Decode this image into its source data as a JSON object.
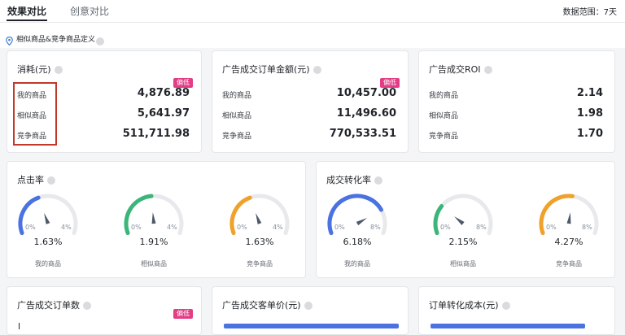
{
  "tabs": [
    {
      "label": "效果对比",
      "active": true
    },
    {
      "label": "创意对比",
      "active": false
    }
  ],
  "range_label": "数据范围：7天",
  "subheader": {
    "label": "相似商品&竞争商品定义"
  },
  "colors": {
    "badge": "#e33d86",
    "gauge_mine": "#4a72e0",
    "gauge_similar": "#3bb57a",
    "gauge_competitor": "#f0a12a",
    "track": "#e8e9ec",
    "highlight": "#c0392b"
  },
  "cards": {
    "spend": {
      "title": "消耗(元)",
      "badge": "偏低",
      "rows": [
        {
          "label": "我的商品",
          "value": "4,876.89"
        },
        {
          "label": "相似商品",
          "value": "5,641.97"
        },
        {
          "label": "竞争商品",
          "value": "511,711.98"
        }
      ]
    },
    "order_amount": {
      "title": "广告成交订单金额(元)",
      "badge": "偏低",
      "rows": [
        {
          "label": "我的商品",
          "value": "10,457.00"
        },
        {
          "label": "相似商品",
          "value": "11,496.60"
        },
        {
          "label": "竞争商品",
          "value": "770,533.51"
        }
      ]
    },
    "roi": {
      "title": "广告成交ROI",
      "rows": [
        {
          "label": "我的商品",
          "value": "2.14"
        },
        {
          "label": "相似商品",
          "value": "1.98"
        },
        {
          "label": "竞争商品",
          "value": "1.70"
        }
      ]
    },
    "ctr": {
      "title": "点击率",
      "min": "0%",
      "max": "4%",
      "gauges": [
        {
          "name": "我的商品",
          "value_label": "1.63%",
          "value": 1.63,
          "max": 4,
          "color_key": "gauge_mine"
        },
        {
          "name": "相似商品",
          "value_label": "1.91%",
          "value": 1.91,
          "max": 4,
          "color_key": "gauge_similar"
        },
        {
          "name": "竞争商品",
          "value_label": "1.63%",
          "value": 1.63,
          "max": 4,
          "color_key": "gauge_competitor"
        }
      ]
    },
    "cvr": {
      "title": "成交转化率",
      "min": "0%",
      "max": "8%",
      "gauges": [
        {
          "name": "我的商品",
          "value_label": "6.18%",
          "value": 6.18,
          "max": 8,
          "color_key": "gauge_mine"
        },
        {
          "name": "相似商品",
          "value_label": "2.15%",
          "value": 2.15,
          "max": 8,
          "color_key": "gauge_similar"
        },
        {
          "name": "竞争商品",
          "value_label": "4.27%",
          "value": 4.27,
          "max": 8,
          "color_key": "gauge_competitor"
        }
      ]
    },
    "order_count": {
      "title": "广告成交订单数",
      "badge": "偏低"
    },
    "avg_price": {
      "title": "广告成交客单价(元)"
    },
    "order_cost": {
      "title": "订单转化成本(元)"
    }
  }
}
